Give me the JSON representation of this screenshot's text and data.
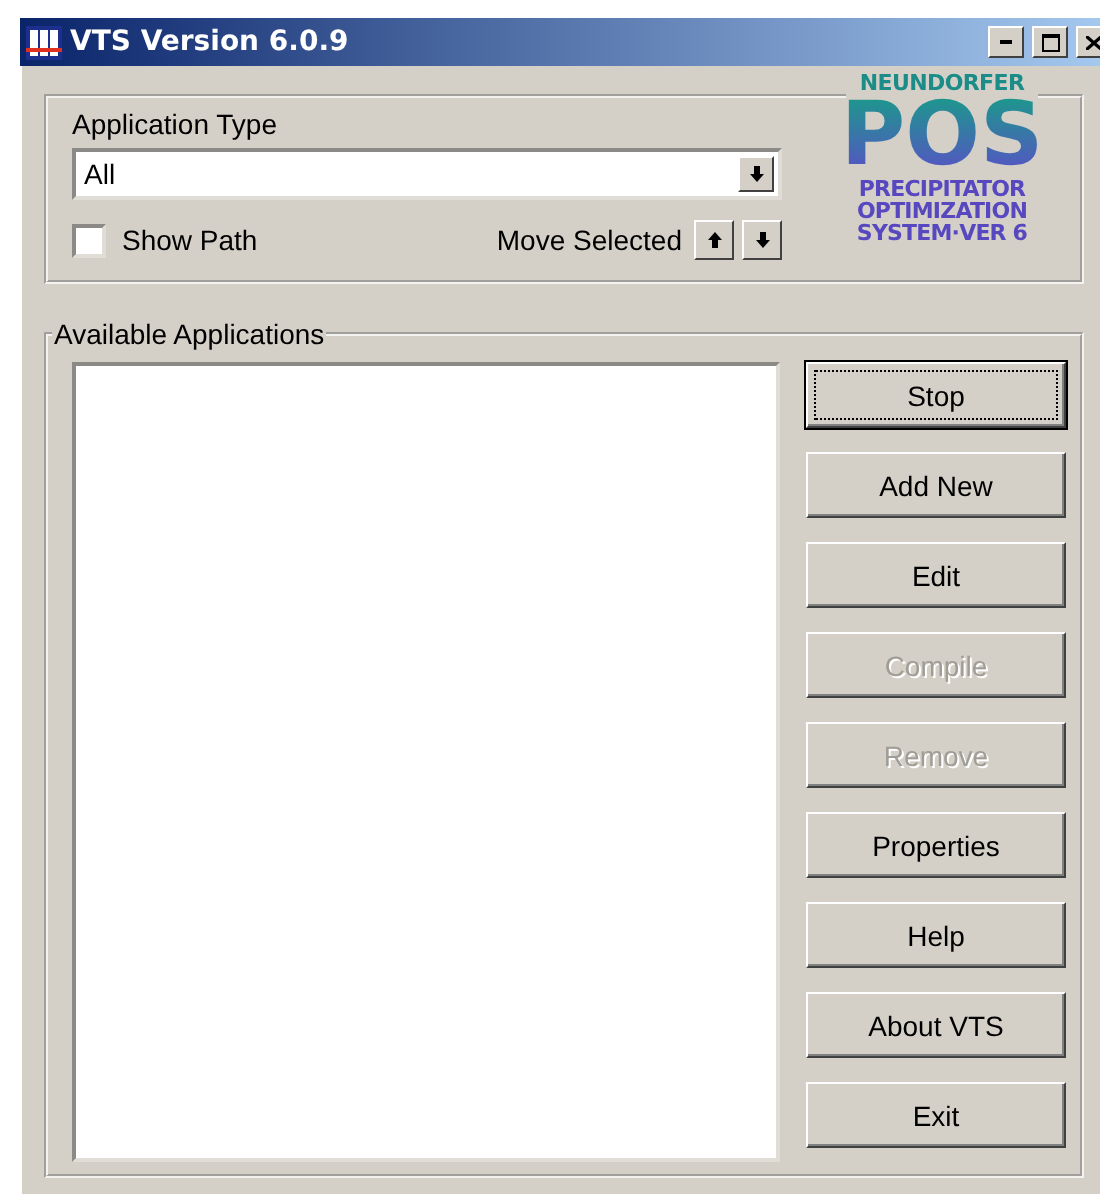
{
  "window": {
    "title": "VTS Version 6.0.9"
  },
  "application_type": {
    "label": "Application Type",
    "value": "All"
  },
  "show_path": {
    "label": "Show Path",
    "checked": false
  },
  "move_selected": {
    "label": "Move Selected"
  },
  "logo": {
    "top": "NEUNDORFER",
    "main": "POS",
    "lines": [
      "PRECIPITATOR",
      "OPTIMIZATION",
      "SYSTEM·VER 6"
    ]
  },
  "available_applications": {
    "label": "Available Applications"
  },
  "buttons": [
    {
      "label": "Stop",
      "disabled": false,
      "focused": true
    },
    {
      "label": "Add New",
      "disabled": false,
      "focused": false
    },
    {
      "label": "Edit",
      "disabled": false,
      "focused": false
    },
    {
      "label": "Compile",
      "disabled": true,
      "focused": false
    },
    {
      "label": "Remove",
      "disabled": true,
      "focused": false
    },
    {
      "label": "Properties",
      "disabled": false,
      "focused": false
    },
    {
      "label": "Help",
      "disabled": false,
      "focused": false
    },
    {
      "label": "About VTS",
      "disabled": false,
      "focused": false
    },
    {
      "label": "Exit",
      "disabled": false,
      "focused": false
    }
  ]
}
